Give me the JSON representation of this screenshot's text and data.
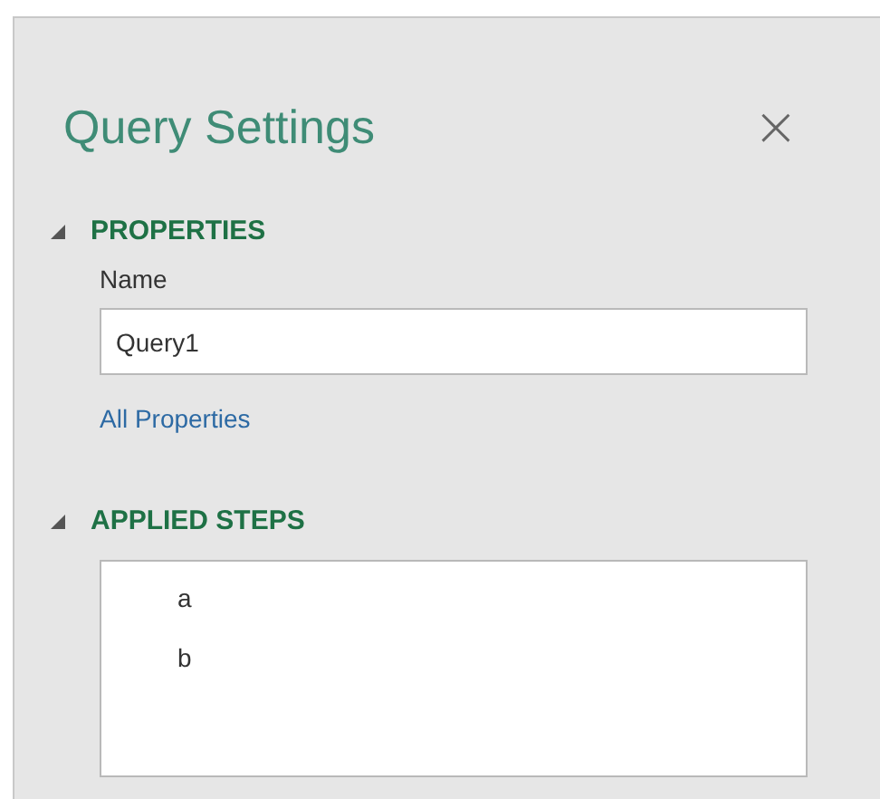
{
  "panel": {
    "title": "Query Settings",
    "close": "×"
  },
  "properties": {
    "heading": "PROPERTIES",
    "expanded": true,
    "name_label": "Name",
    "name_value": "Query1",
    "link": "All Properties"
  },
  "applied_steps": {
    "heading": "APPLIED STEPS",
    "expanded": true,
    "steps": [
      {
        "label": "a"
      },
      {
        "label": "b"
      }
    ]
  }
}
